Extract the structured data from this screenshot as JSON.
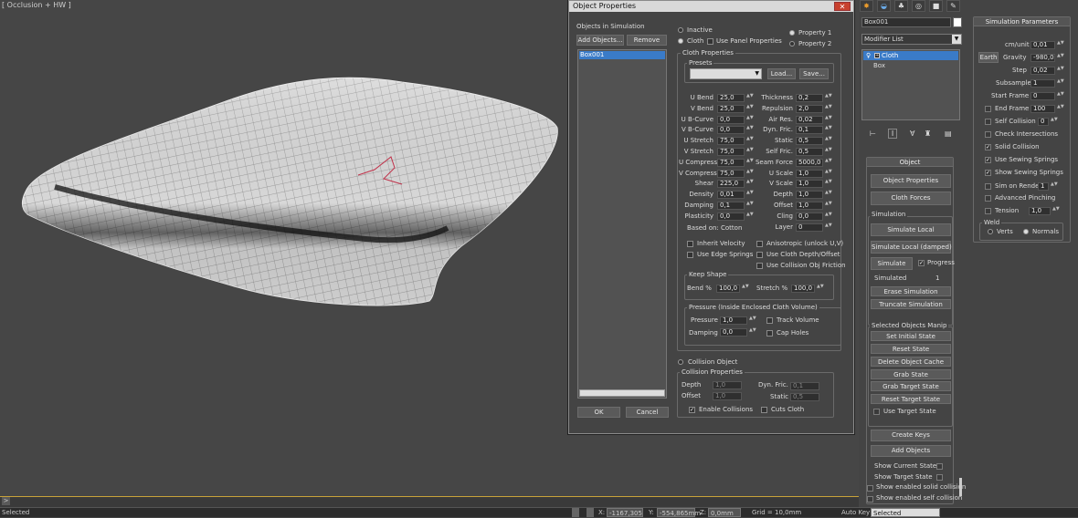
{
  "viewport": {
    "label": "[ Occlusion + HW ]"
  },
  "timeline": {
    "arrow": ">"
  },
  "status": {
    "selected": "Selected",
    "x_label": "X:",
    "x_value": "-1167,305",
    "y_label": "Y:",
    "y_value": "-554,865mm",
    "z_label": "Z:",
    "z_value": "0,0mm",
    "grid": "Grid = 10,0mm",
    "autokey": "Auto Key",
    "sel_dropdown": "Selected"
  },
  "dialog": {
    "title": "Object Properties",
    "close": "✕",
    "objects_label": "Objects in Simulation",
    "add_objects": "Add Objects...",
    "remove": "Remove",
    "list": [
      "Box001"
    ],
    "ok": "OK",
    "cancel": "Cancel",
    "inactive": "Inactive",
    "cloth": "Cloth",
    "use_panel_props": "Use Panel Properties",
    "property1": "Property 1",
    "property2": "Property 2",
    "cloth_props": "Cloth Properties",
    "presets": "Presets",
    "load": "Load...",
    "save": "Save...",
    "left_params": [
      {
        "label": "U Bend",
        "value": "25,0"
      },
      {
        "label": "V Bend",
        "value": "25,0"
      },
      {
        "label": "U B-Curve",
        "value": "0,0"
      },
      {
        "label": "V B-Curve",
        "value": "0,0"
      },
      {
        "label": "U Stretch",
        "value": "75,0"
      },
      {
        "label": "V Stretch",
        "value": "75,0"
      },
      {
        "label": "U Compress",
        "value": "75,0"
      },
      {
        "label": "V Compress",
        "value": "75,0"
      },
      {
        "label": "Shear",
        "value": "225,0"
      },
      {
        "label": "Density",
        "value": "0,01"
      },
      {
        "label": "Damping",
        "value": "0,1"
      },
      {
        "label": "Plasticity",
        "value": "0,0"
      }
    ],
    "right_params": [
      {
        "label": "Thickness",
        "value": "0,2"
      },
      {
        "label": "Repulsion",
        "value": "2,0"
      },
      {
        "label": "Air Res.",
        "value": "0,02"
      },
      {
        "label": "Dyn. Fric.",
        "value": "0,1"
      },
      {
        "label": "Static",
        "value": "0,5"
      },
      {
        "label": "Self Fric.",
        "value": "0,5"
      },
      {
        "label": "Seam Force",
        "value": "5000,0"
      },
      {
        "label": "U Scale",
        "value": "1,0"
      },
      {
        "label": "V Scale",
        "value": "1,0"
      },
      {
        "label": "Depth",
        "value": "1,0"
      },
      {
        "label": "Offset",
        "value": "1,0"
      },
      {
        "label": "Cling",
        "value": "0,0"
      },
      {
        "label": "Layer",
        "value": "0"
      }
    ],
    "based_on": "Based on: Cotton",
    "inherit_velocity": "Inherit Velocity",
    "use_edge_springs": "Use Edge Springs",
    "anisotropic": "Anisotropic (unlock U,V)",
    "use_cloth_depth": "Use Cloth Depth/Offset",
    "use_collision_friction": "Use Collision Obj Friction",
    "keep_shape": "Keep Shape",
    "bend_pct": "Bend %",
    "bend_pct_value": "100,0",
    "stretch_pct": "Stretch %",
    "stretch_pct_value": "100,0",
    "pressure_title": "Pressure (Inside Enclosed Cloth Volume)",
    "pressure": "Pressure",
    "pressure_value": "1,0",
    "damping": "Damping",
    "damping_value": "0,0",
    "track_volume": "Track Volume",
    "cap_holes": "Cap Holes",
    "collision_object": "Collision Object",
    "collision_props": "Collision Properties",
    "c_depth": "Depth",
    "c_depth_value": "1,0",
    "c_offset": "Offset",
    "c_offset_value": "1,0",
    "c_dynfric": "Dyn. Fric.",
    "c_dynfric_value": "0,1",
    "c_static": "Static",
    "c_static_value": "0,5",
    "enable_collisions": "Enable Collisions",
    "cuts_cloth": "Cuts Cloth"
  },
  "panel": {
    "object_name": "Box001",
    "modifier_list": "Modifier List",
    "stack": [
      "Cloth",
      "Box"
    ],
    "object_title": "Object",
    "object_properties": "Object Properties",
    "cloth_forces": "Cloth Forces",
    "simulation": "Simulation",
    "simulate_local": "Simulate Local",
    "simulate_local_damped": "Simulate Local (damped)",
    "simulate": "Simulate",
    "progress": "Progress",
    "simulated": "Simulated",
    "simulated_value": "1",
    "erase_simulation": "Erase Simulation",
    "truncate_simulation": "Truncate Simulation",
    "selected_manip": "Selected Objects Manip",
    "set_initial_state": "Set Initial State",
    "reset_state": "Reset State",
    "delete_object_cache": "Delete Object Cache",
    "grab_state": "Grab State",
    "grab_target_state": "Grab Target State",
    "reset_target_state": "Reset Target State",
    "use_target_state": "Use Target State",
    "create_keys": "Create Keys",
    "add_objects": "Add Objects",
    "show_current_state": "Show Current State",
    "show_target_state": "Show Target State",
    "show_enabled_solid": "Show enabled solid collision",
    "show_enabled_self": "Show enabled self collision"
  },
  "sim_params": {
    "title": "Simulation Parameters",
    "cm_unit": "cm/unit",
    "cm_unit_value": "0,01",
    "earth": "Earth",
    "gravity": "Gravity",
    "gravity_value": "-980,0",
    "step": "Step",
    "step_value": "0,02",
    "subsample": "Subsample",
    "subsample_value": "1",
    "start_frame": "Start Frame",
    "start_frame_value": "0",
    "end_frame": "End Frame",
    "end_frame_value": "100",
    "self_collision": "Self Collision",
    "self_collision_value": "0",
    "check_intersections": "Check Intersections",
    "solid_collision": "Solid Collision",
    "use_sewing_springs": "Use Sewing Springs",
    "show_sewing_springs": "Show Sewing Springs",
    "sim_on_render": "Sim on Render",
    "sim_on_render_value": "1",
    "advanced_pinching": "Advanced Pinching",
    "tension": "Tension",
    "tension_value": "1,0",
    "weld": "Weld",
    "verts": "Verts",
    "normals": "Normals"
  }
}
